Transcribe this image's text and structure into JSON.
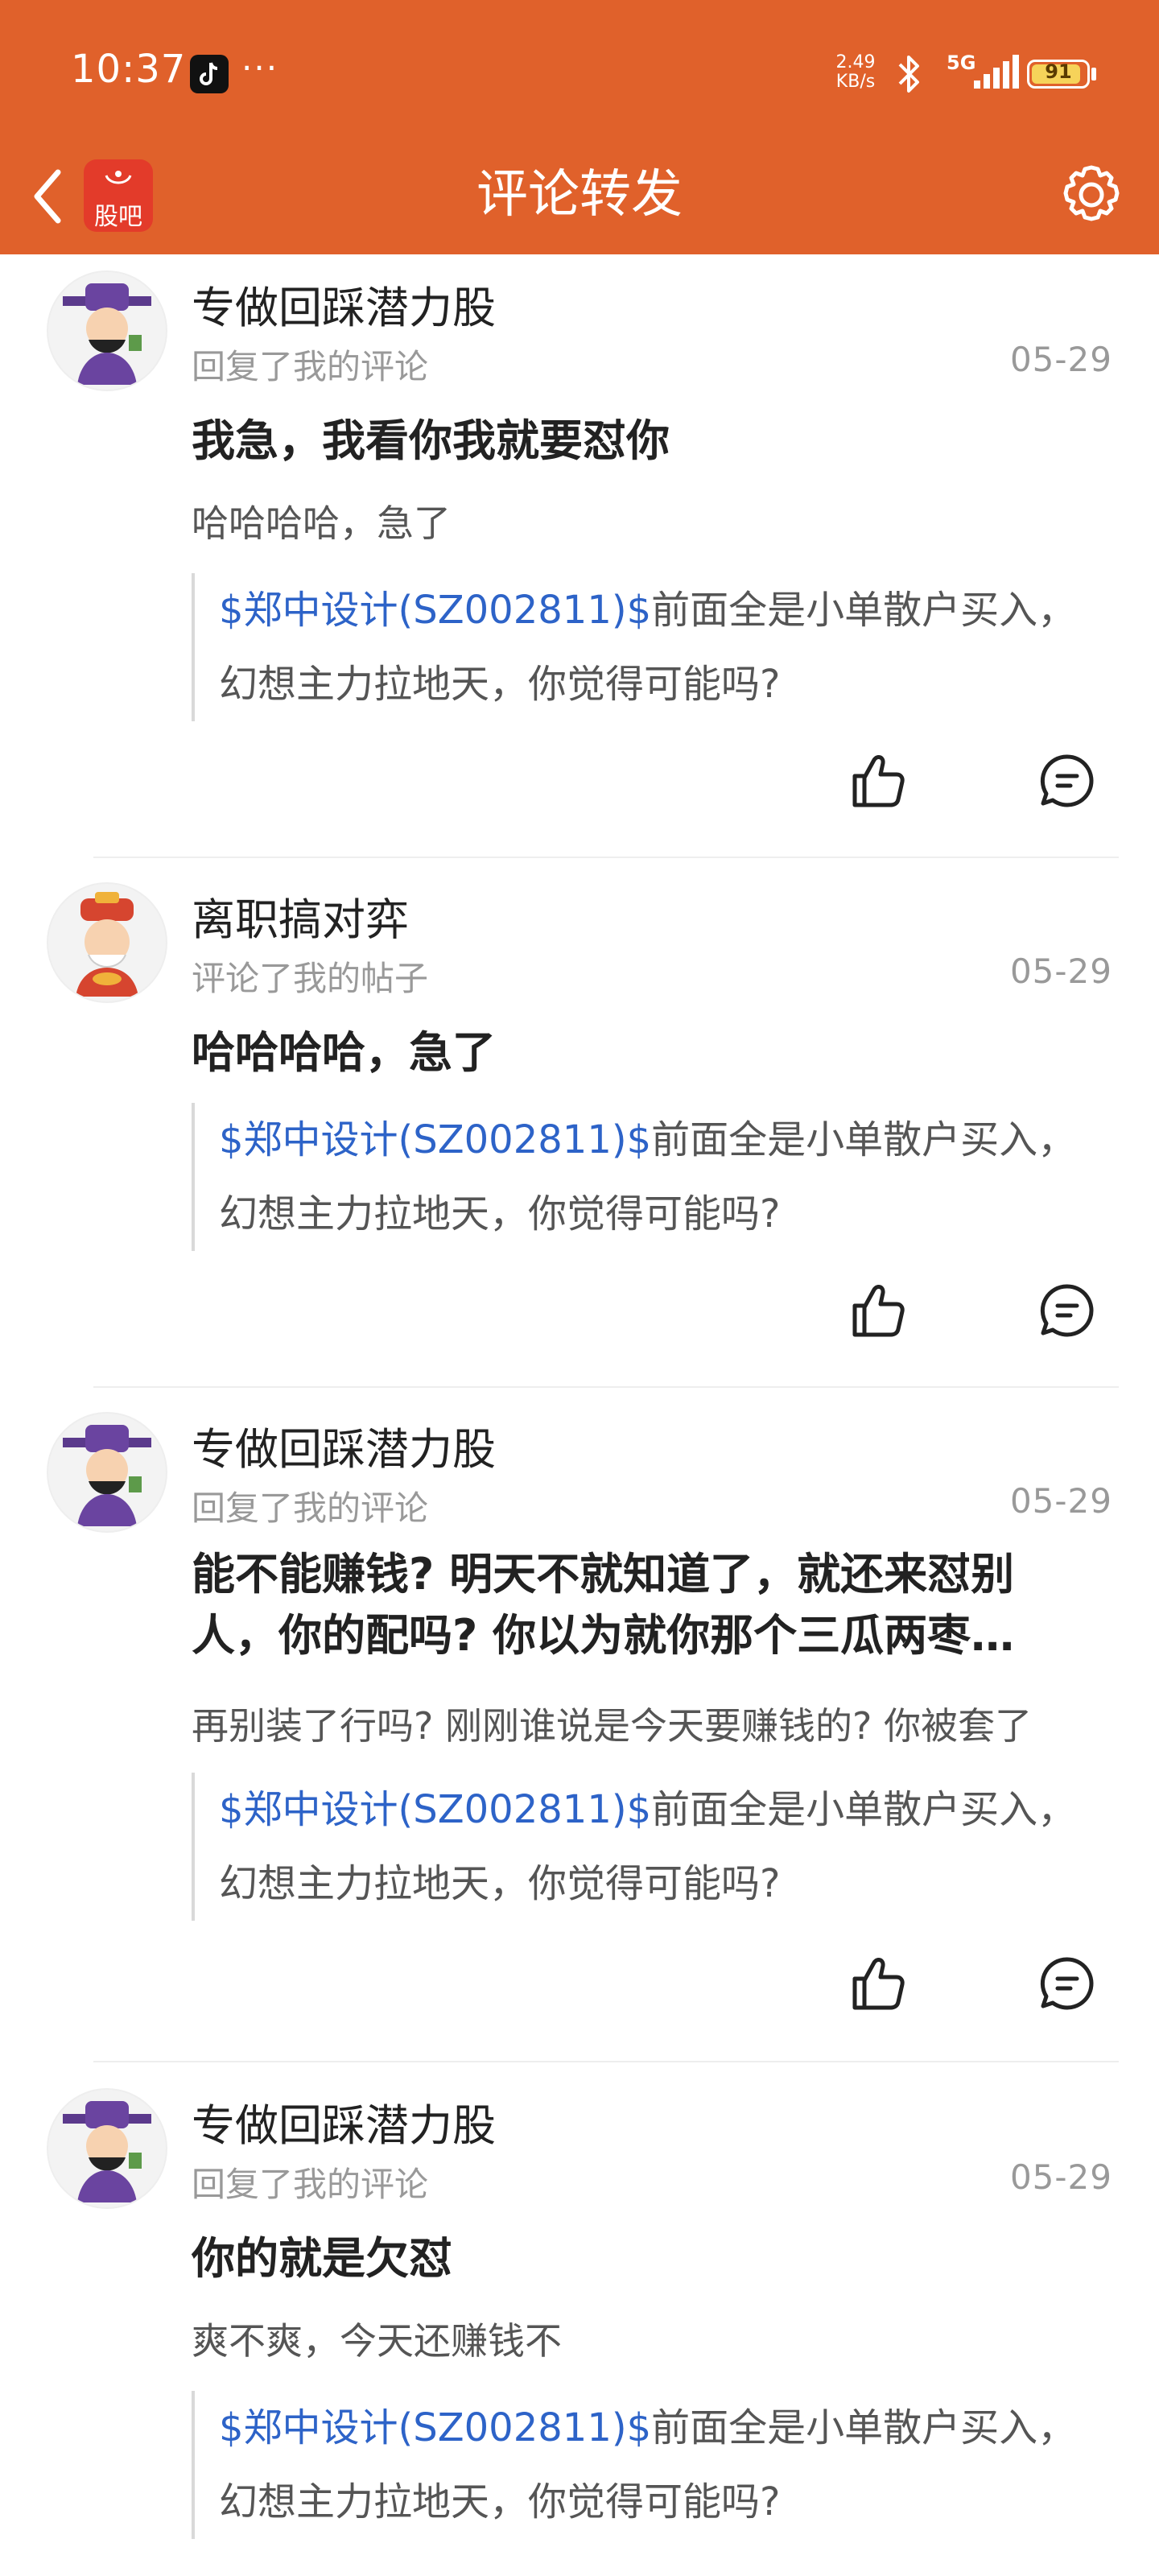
{
  "status_bar": {
    "time": "10:37",
    "dots": "···",
    "net_speed_value": "2.49",
    "net_speed_unit": "KB/s",
    "network": "5G",
    "battery": "91",
    "battery_level": 0.91,
    "icons": [
      "tiktok-icon",
      "bluetooth-icon",
      "signal-icon",
      "battery-icon"
    ]
  },
  "nav": {
    "back_icon": "chevron-left-icon",
    "logo_text": "股吧",
    "title": "评论转发",
    "settings_icon": "gear-icon",
    "accent_color": "#e0612b"
  },
  "items": [
    {
      "username": "专做回踩潜力股",
      "action": "回复了我的评论",
      "date": "05-29",
      "title_line1": "我急，我看你我就要怼你",
      "title_line2": "",
      "subtitle": "哈哈哈哈，急了",
      "quote_stock": "$郑中设计(SZ002811)$",
      "quote_rest": "前面全是小单散户买入，幻想主力拉地天，你觉得可能吗?"
    },
    {
      "username": "离职搞对弈",
      "action": "评论了我的帖子",
      "date": "05-29",
      "title_line1": "哈哈哈哈，急了",
      "title_line2": "",
      "subtitle": "",
      "quote_stock": "$郑中设计(SZ002811)$",
      "quote_rest": "前面全是小单散户买入，幻想主力拉地天，你觉得可能吗?"
    },
    {
      "username": "专做回踩潜力股",
      "action": "回复了我的评论",
      "date": "05-29",
      "title_line1": "能不能赚钱? 明天不就知道了，就还来怼别",
      "title_line2": "人，你的配吗? 你以为就你那个三瓜两枣…",
      "subtitle": "再别装了行吗? 刚刚谁说是今天要赚钱的? 你被套了",
      "quote_stock": "$郑中设计(SZ002811)$",
      "quote_rest": "前面全是小单散户买入，幻想主力拉地天，你觉得可能吗?"
    },
    {
      "username": "专做回踩潜力股",
      "action": "回复了我的评论",
      "date": "05-29",
      "title_line1": "你的就是欠怼",
      "title_line2": "",
      "subtitle": "爽不爽，今天还赚钱不",
      "quote_stock": "$郑中设计(SZ002811)$",
      "quote_rest": "前面全是小单散户买入，幻想主力拉地天，你觉得可能吗?"
    }
  ],
  "icons": {
    "like": "thumbs-up-icon",
    "reply": "comment-icon"
  },
  "colors": {
    "stock_link": "#2d63c8",
    "meta_gray": "#999999"
  }
}
